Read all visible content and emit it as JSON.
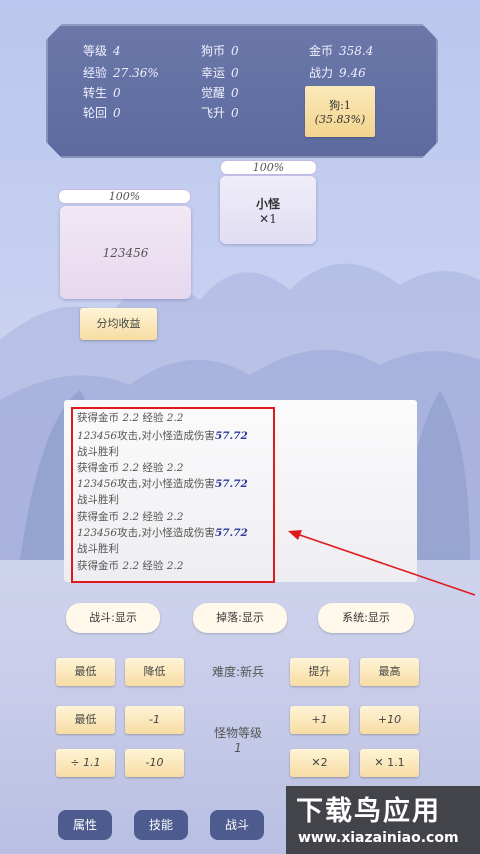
{
  "stats": {
    "level": {
      "label": "等级",
      "value": "4"
    },
    "exp": {
      "label": "经验",
      "value": "27.36%"
    },
    "rebirth": {
      "label": "转生",
      "value": "0"
    },
    "reincarnation": {
      "label": "轮回",
      "value": "0"
    },
    "dog_coin": {
      "label": "狗币",
      "value": "0"
    },
    "luck": {
      "label": "幸运",
      "value": "0"
    },
    "awaken": {
      "label": "觉醒",
      "value": "0"
    },
    "ascend": {
      "label": "飞升",
      "value": "0"
    },
    "gold": {
      "label": "金币",
      "value": "358.4"
    },
    "power": {
      "label": "战力",
      "value": "9.46"
    }
  },
  "pet": {
    "line1": "狗:1",
    "line2": "(35.83%)"
  },
  "player": {
    "hp": "100%",
    "name": "123456"
  },
  "monster": {
    "hp": "100%",
    "name": "小怪",
    "count": "✕1"
  },
  "split_button": "分均收益",
  "log": [
    {
      "type": "reward",
      "gold_label": "获得金币",
      "gold": "2.2",
      "exp_label": "经验",
      "exp": "2.2"
    },
    {
      "type": "attack",
      "actor": "123456",
      "text": "攻击,对小怪造成伤害",
      "damage": "57.72"
    },
    {
      "type": "text",
      "text": "战斗胜利"
    },
    {
      "type": "reward",
      "gold_label": "获得金币",
      "gold": "2.2",
      "exp_label": "经验",
      "exp": "2.2"
    },
    {
      "type": "attack",
      "actor": "123456",
      "text": "攻击,对小怪造成伤害",
      "damage": "57.72"
    },
    {
      "type": "text",
      "text": "战斗胜利"
    },
    {
      "type": "reward",
      "gold_label": "获得金币",
      "gold": "2.2",
      "exp_label": "经验",
      "exp": "2.2"
    },
    {
      "type": "attack",
      "actor": "123456",
      "text": "攻击,对小怪造成伤害",
      "damage": "57.72"
    },
    {
      "type": "text",
      "text": "战斗胜利"
    },
    {
      "type": "reward",
      "gold_label": "获得金币",
      "gold": "2.2",
      "exp_label": "经验",
      "exp": "2.2"
    }
  ],
  "filters": {
    "battle": "战斗:显示",
    "drop": "掉落:显示",
    "system": "系统:显示"
  },
  "difficulty": {
    "label": "难度:新兵",
    "lowest": "最低",
    "lower": "降低",
    "raise": "提升",
    "highest": "最高"
  },
  "monster_level": {
    "label": "怪物等级",
    "value": "1",
    "min": "最低",
    "minus1": "-1",
    "div": "÷ 1.1",
    "minus10": "-10",
    "plus1": "+1",
    "plus10": "+10",
    "times2": "✕2",
    "times11": "✕ 1.1"
  },
  "nav": {
    "attributes": "属性",
    "skills": "技能",
    "battle": "战斗"
  },
  "watermark": {
    "title": "下载鸟应用",
    "url": "www.xiazainiao.com"
  },
  "colors": {
    "highlight": "#e0191c",
    "arrow": "#e0191c",
    "panel": "#5d6aa0"
  }
}
